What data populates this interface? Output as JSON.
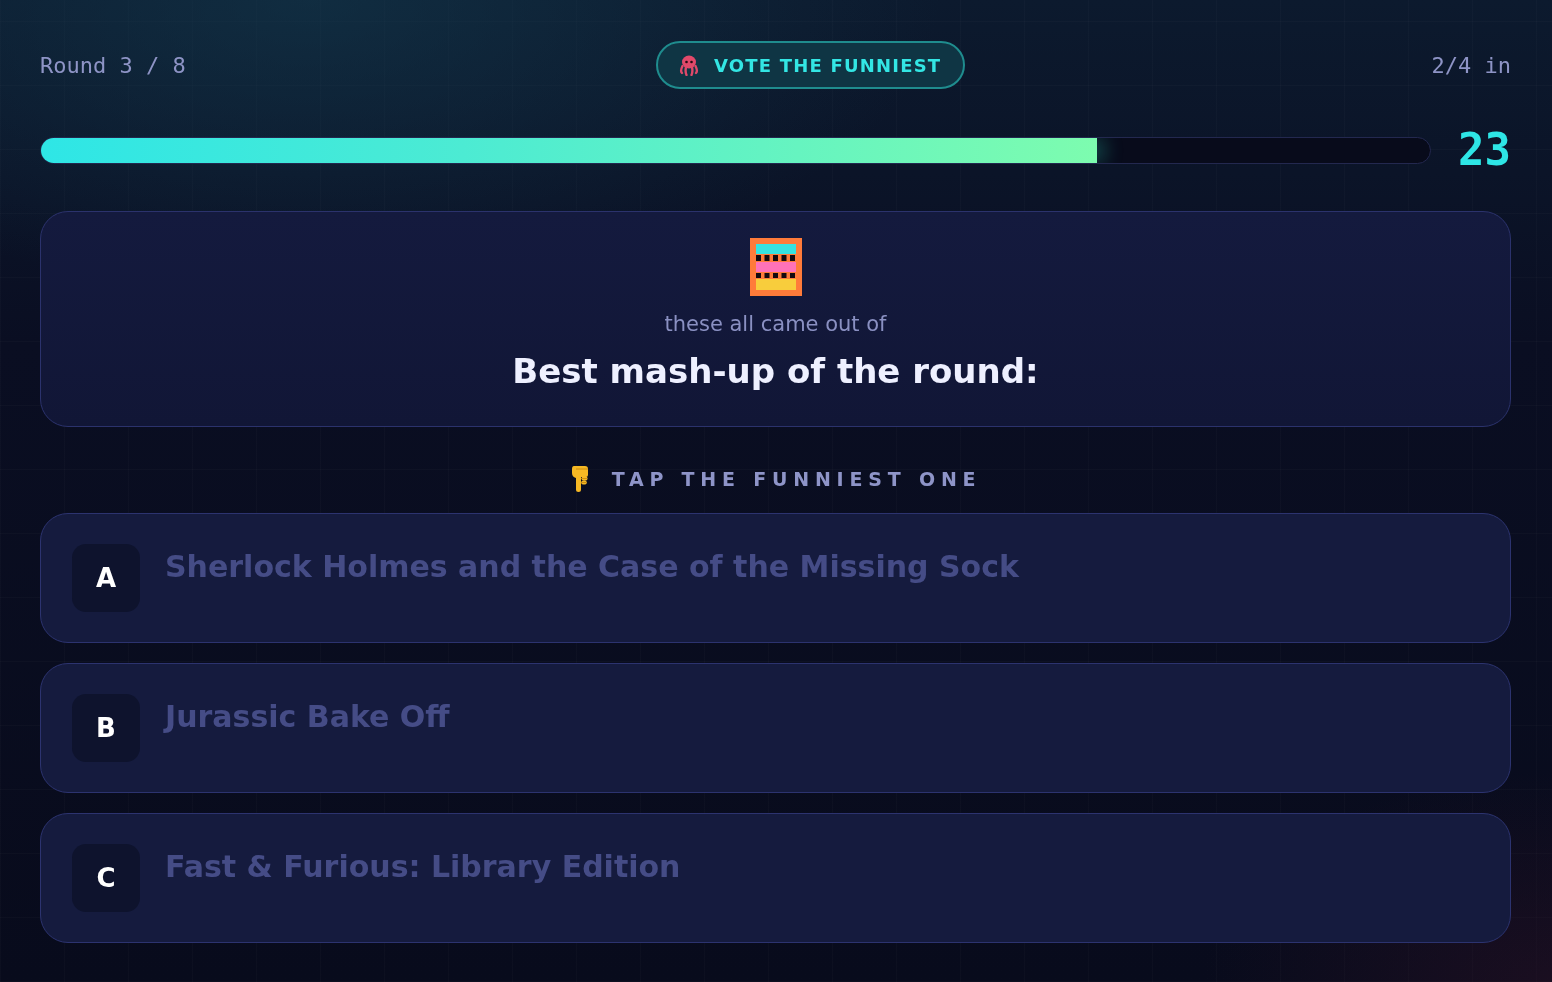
{
  "header": {
    "round": "Round 3 / 8",
    "phase": "VOTE THE FUNNIEST",
    "submitted": "2/4 in"
  },
  "timer": {
    "level": 0.76,
    "seconds": "23"
  },
  "prompt_card": {
    "subtitle": "these all came out of",
    "title": "Best mash-up of the round:"
  },
  "instruction": "TAP THE FUNNIEST ONE",
  "options": [
    {
      "letter": "A",
      "text": "Sherlock Holmes and the Case of the Missing Sock"
    },
    {
      "letter": "B",
      "text": "Jurassic Bake Off"
    },
    {
      "letter": "C",
      "text": "Fast & Furious: Library Edition"
    }
  ]
}
